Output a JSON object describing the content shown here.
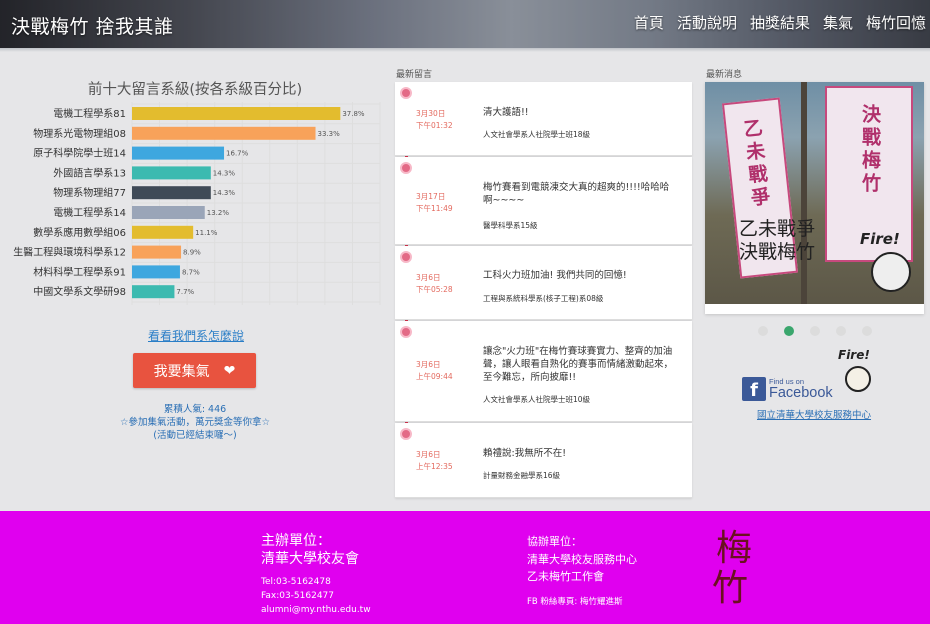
{
  "header": {
    "site_title": "決戰梅竹 捨我其誰",
    "nav": [
      "首頁",
      "活動說明",
      "抽獎結果",
      "集氣",
      "梅竹回憶"
    ]
  },
  "ranking": {
    "title": "前十大留言系級(按各系級百分比)",
    "link": "看看我們系怎麼說",
    "button_label": "我要集氣",
    "stats": {
      "count": "累積人氣: 446",
      "promo": "☆參加集氣活動，萬元獎金等你拿☆",
      "ended": "(活動已經結束囉～)"
    }
  },
  "chart_data": {
    "type": "bar",
    "orientation": "horizontal",
    "categories": [
      "電機工程學系81",
      "物理系光電物理組08",
      "原子科學院學士班14",
      "外國語言學系13",
      "物理系物理組77",
      "電機工程學系14",
      "數學系應用數學組06",
      "生醫工程與環境科學系12",
      "材料科學工程學系91",
      "中國文學系文學研98"
    ],
    "values": [
      37.8,
      33.3,
      16.7,
      14.3,
      14.3,
      13.2,
      11.1,
      8.9,
      8.7,
      7.7
    ],
    "value_labels": [
      "37.8%",
      "33.3%",
      "16.7%",
      "14.3%",
      "14.3%",
      "13.2%",
      "11.1%",
      "8.9%",
      "8.7%",
      "7.7%"
    ],
    "colors": [
      "#e3bc2e",
      "#f8a25a",
      "#3ea7df",
      "#3cbab0",
      "#3f4a57",
      "#9aa5b8",
      "#e3bc2e",
      "#f8a25a",
      "#3ea7df",
      "#3cbab0"
    ],
    "xlim": [
      0,
      45
    ],
    "grid": true
  },
  "messages": {
    "label": "最新留言",
    "items": [
      {
        "date": "3月30日",
        "time": "下午01:32",
        "text": "清大護語!!",
        "author": "人文社會學系人社院學士班18級"
      },
      {
        "date": "3月17日",
        "time": "下午11:49",
        "text": "梅竹賽看到電競凍交大真的超爽的!!!!哈哈哈啊~~~~",
        "author": "醫學科學系15級"
      },
      {
        "date": "3月6日",
        "time": "下午05:28",
        "text": "工科火力班加油! 我們共同的回憶!",
        "author": "工程與系統科學系(核子工程)系08級"
      },
      {
        "date": "3月6日",
        "time": "上午09:44",
        "text": "讓念\"火力班\"在梅竹賽球賽實力、整齊的加油聲，讓人眼看自熟化的賽事而情緒激動起來，至今難忘，所向披靡!!",
        "author": "人文社會學系人社院學士班10級"
      },
      {
        "date": "3月6日",
        "time": "上午12:35",
        "text": "賴禮說:我無所不在!",
        "author": "計量財務金融學系16級"
      }
    ]
  },
  "news": {
    "label": "最新消息",
    "banner_left": "乙未戰爭",
    "banner_right": "決戰梅竹",
    "caption_line1": "乙未戰爭",
    "caption_line2": "決戰梅竹",
    "mascot_text": "Fire!",
    "dots": 5,
    "active_dot": 1
  },
  "facebook": {
    "find_us": "Find us on",
    "brand": "Facebook",
    "fire": "Fire!",
    "link": "國立清華大學校友服務中心"
  },
  "footer": {
    "organizer_label": "主辦單位：",
    "organizer_name": "清華大學校友會",
    "tel": "Tel:03-5162478",
    "fax": "Fax:03-5162477",
    "email": "alumni@my.nthu.edu.tw",
    "co_label": "協辦單位：",
    "co_items": [
      "清華大學校友服務中心",
      "乙未梅竹工作會"
    ],
    "fb_fan": "FB 粉絲專頁: 梅竹耀進斯",
    "seal_chars": [
      "梅",
      "竹"
    ]
  },
  "colors": {
    "accent_red": "#e8533f",
    "timeline": "#d9324f",
    "footer": "#e000ef",
    "link_blue": "#2a6fb5",
    "active_dot": "#3aa66d"
  }
}
